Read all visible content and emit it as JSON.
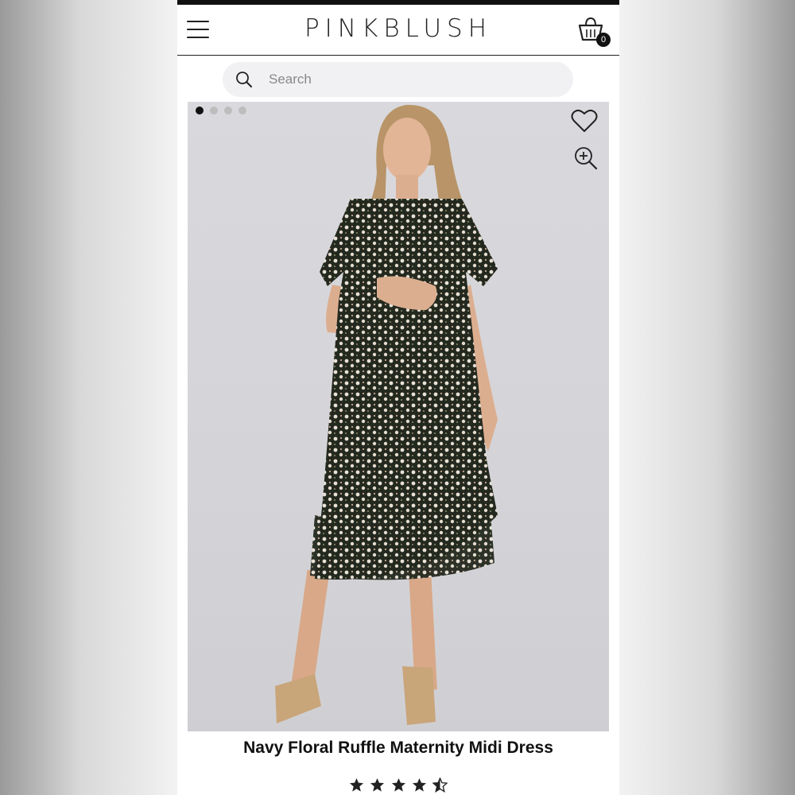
{
  "header": {
    "logo": "PINKBLUSH",
    "cart_count": "0"
  },
  "search": {
    "placeholder": "Search"
  },
  "gallery": {
    "image_count": 4,
    "active_index": 0
  },
  "product": {
    "title": "Navy Floral Ruffle Maternity Midi Dress",
    "rating": 4.5,
    "rating_max": 5
  },
  "icons": [
    "menu-icon",
    "cart-icon",
    "search-icon",
    "heart-icon",
    "zoom-in-icon",
    "star-icon"
  ],
  "colors": {
    "ink": "#111111",
    "photo_bg": "#d6d6da",
    "search_bg": "#f1f1f3"
  }
}
